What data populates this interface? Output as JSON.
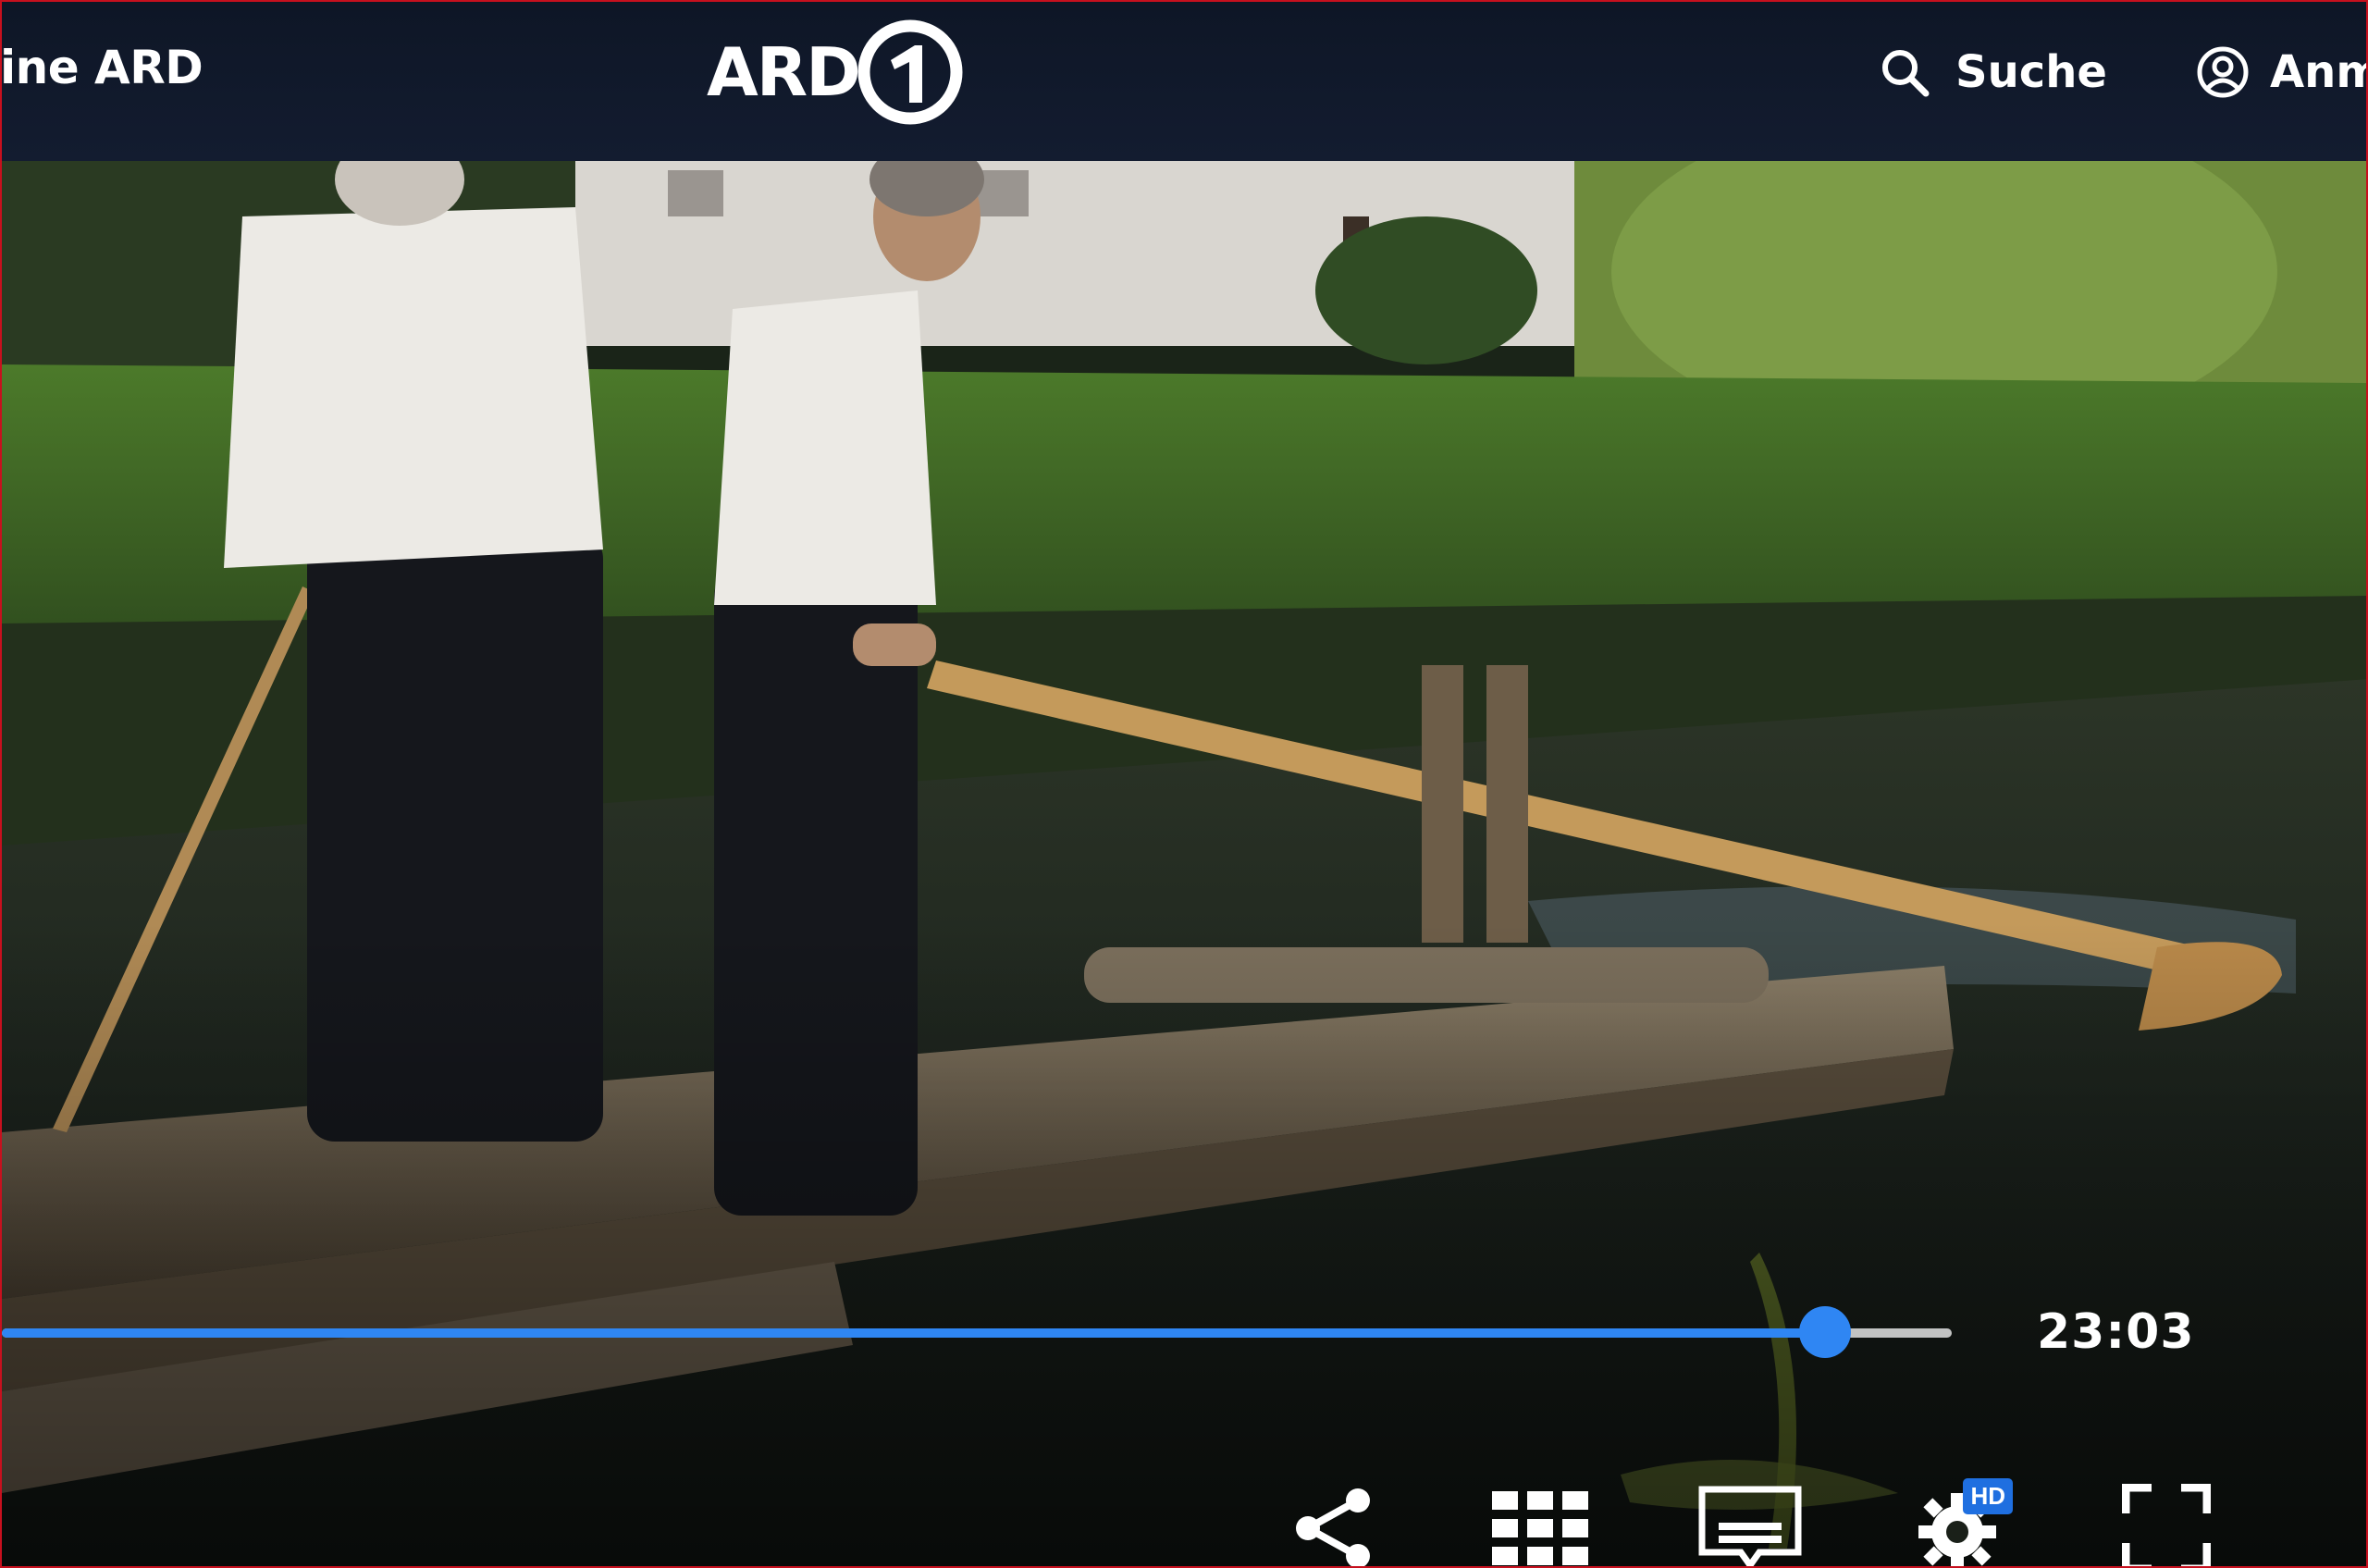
{
  "header": {
    "brand_text": "ine ARD",
    "logo_word": "ARD",
    "logo_numeral": "1",
    "search_label": "Suche",
    "login_label": "Anm",
    "search_icon": "search-icon",
    "login_icon": "user-circle-icon"
  },
  "player": {
    "progress_fraction": 0.935,
    "time": "23:03",
    "controls": {
      "share_icon": "share-icon",
      "chapters_icon": "grid-icon",
      "subtitles_icon": "subtitles-icon",
      "settings_icon": "gear-icon",
      "settings_badge": "HD",
      "fullscreen_icon": "fullscreen-icon"
    }
  },
  "colors": {
    "header_bg": "#131c30",
    "accent_blue": "#2f86f3",
    "frame_red": "#c7101e"
  }
}
